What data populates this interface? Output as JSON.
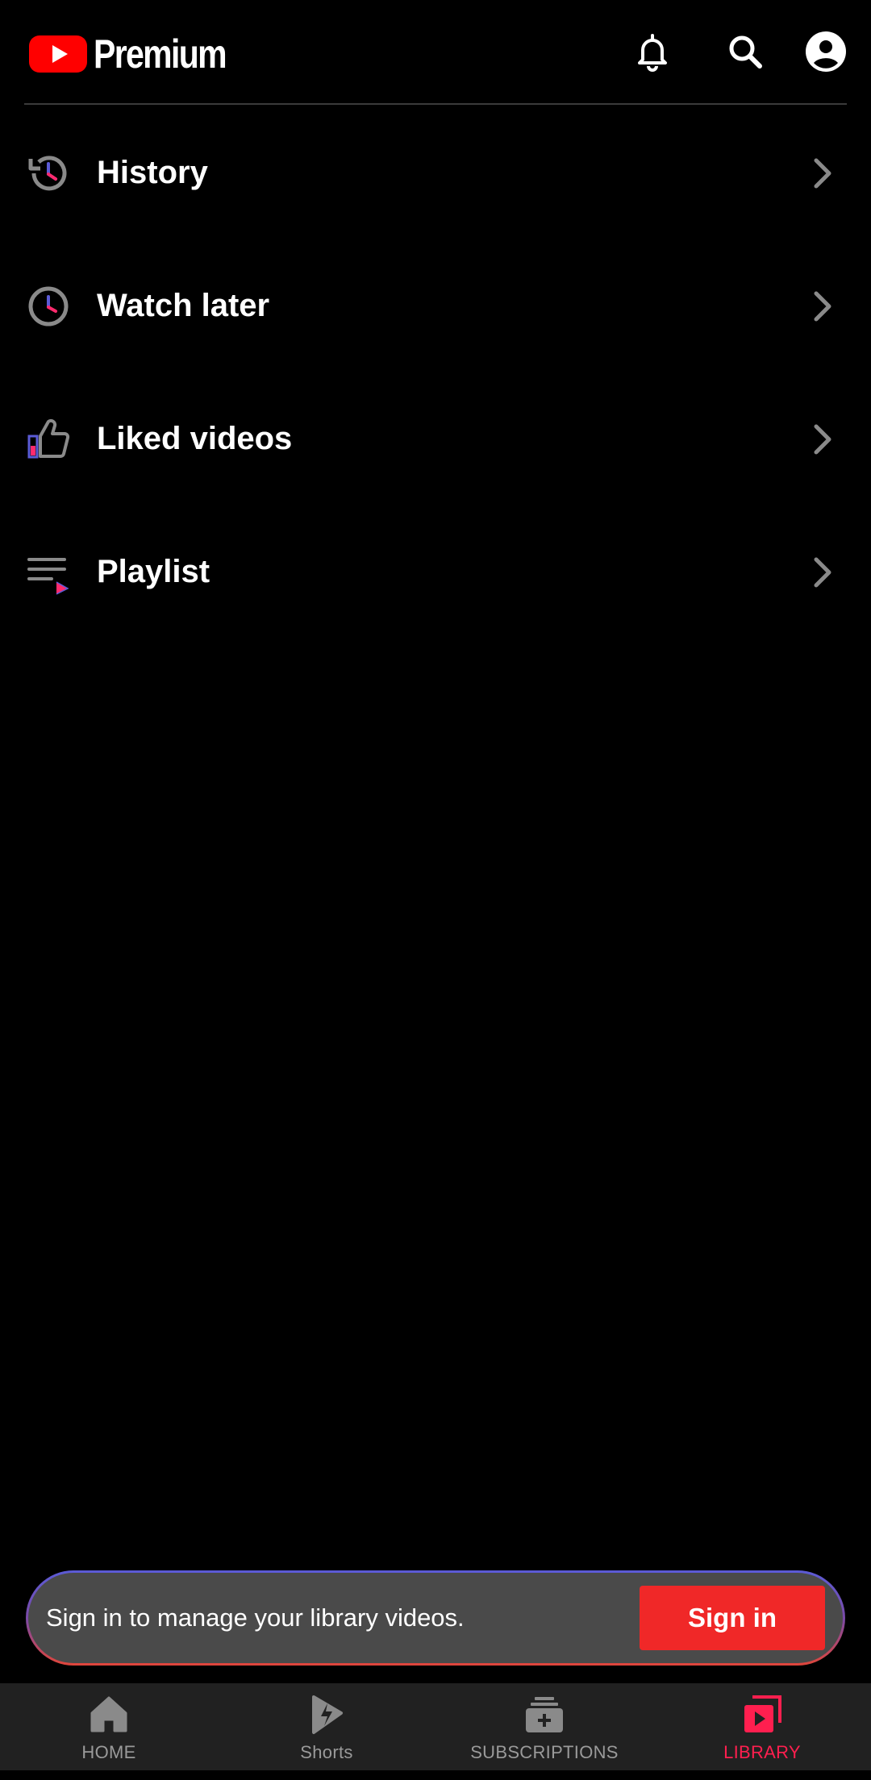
{
  "header": {
    "brand": "Premium",
    "icons": [
      "notifications-icon",
      "search-icon",
      "account-icon"
    ]
  },
  "library": {
    "items": [
      {
        "label": "History",
        "icon": "history-icon"
      },
      {
        "label": "Watch later",
        "icon": "watch-later-icon"
      },
      {
        "label": "Liked videos",
        "icon": "thumb-up-icon"
      },
      {
        "label": "Playlist",
        "icon": "playlist-icon"
      }
    ]
  },
  "banner": {
    "message": "Sign in to manage your library videos.",
    "button": "Sign in"
  },
  "nav": {
    "items": [
      {
        "label": "HOME",
        "icon": "home-icon",
        "active": false
      },
      {
        "label": "Shorts",
        "icon": "shorts-icon",
        "active": false
      },
      {
        "label": "SUBSCRIPTIONS",
        "icon": "subscriptions-icon",
        "active": false
      },
      {
        "label": "LIBRARY",
        "icon": "library-icon",
        "active": true
      }
    ]
  },
  "colors": {
    "background": "#000000",
    "accent": "#f02828",
    "active_nav": "#ff1f4f",
    "nav_bg": "#212121",
    "banner_bg": "#4a4a4a"
  }
}
